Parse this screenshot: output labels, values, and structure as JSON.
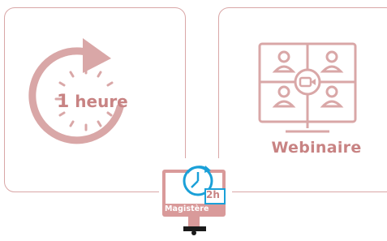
{
  "duration_card": {
    "number": "1",
    "unit": "heure",
    "icon": "clock-arrow-icon"
  },
  "webinar_card": {
    "title": "Webinaire",
    "icon": "video-conference-screen-icon"
  },
  "badge": {
    "platform": "Magistère",
    "duration": "2h",
    "icon": "computer-clock-icon"
  },
  "colors": {
    "accent": "#d9a7a7",
    "text_accent": "#c88383",
    "badge_blue": "#1aa0d8"
  }
}
